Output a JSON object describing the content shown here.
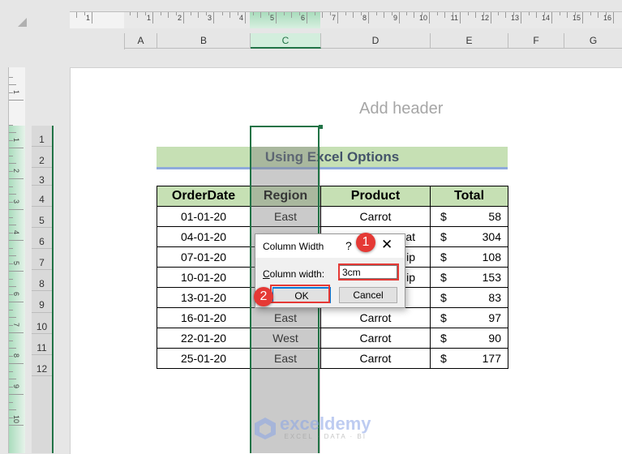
{
  "top_ruler": {
    "labels": [
      "1",
      "1",
      "2",
      "3",
      "4",
      "5",
      "6",
      "7",
      "8",
      "9",
      "10",
      "11",
      "12",
      "13",
      "14",
      "15",
      "16"
    ]
  },
  "left_ruler": {
    "labels": [
      "1",
      "1",
      "2",
      "3",
      "4",
      "5",
      "6",
      "7",
      "8",
      "9",
      "10"
    ]
  },
  "columns": [
    "A",
    "B",
    "C",
    "D",
    "E",
    "F",
    "G"
  ],
  "selected_column": "C",
  "rows": [
    "1",
    "2",
    "3",
    "4",
    "5",
    "6",
    "7",
    "8",
    "9",
    "10",
    "11",
    "12"
  ],
  "page": {
    "header_placeholder": "Add header",
    "title": "Using Excel Options"
  },
  "table": {
    "headers": [
      "OrderDate",
      "Region",
      "Product",
      "Total"
    ],
    "currency_symbol": "$",
    "rows": [
      {
        "date": "01-01-20",
        "region": "East",
        "product": "Carrot",
        "total": "58"
      },
      {
        "date": "04-01-20",
        "region": "",
        "product": "at",
        "total": "304"
      },
      {
        "date": "07-01-20",
        "region": "",
        "product": "ip",
        "total": "108"
      },
      {
        "date": "10-01-20",
        "region": "",
        "product": "ip",
        "total": "153"
      },
      {
        "date": "13-01-20",
        "region": "",
        "product": "",
        "total": "83"
      },
      {
        "date": "16-01-20",
        "region": "East",
        "product": "Carrot",
        "total": "97"
      },
      {
        "date": "22-01-20",
        "region": "West",
        "product": "Carrot",
        "total": "90"
      },
      {
        "date": "25-01-20",
        "region": "East",
        "product": "Carrot",
        "total": "177"
      }
    ]
  },
  "dialog": {
    "title": "Column Width",
    "help_label": "?",
    "close_label": "✕",
    "field_label_accel": "C",
    "field_label_rest": "olumn width:",
    "field_value": "3cm",
    "ok_label": "OK",
    "cancel_label": "Cancel"
  },
  "annotations": {
    "step1": "1",
    "step2": "2",
    "color": "#e53935"
  },
  "watermark": {
    "name": "exceldemy",
    "tagline": "EXCEL · DATA · BI"
  },
  "colors": {
    "excel_green": "#217346",
    "header_fill": "#c6e0b4",
    "title_text": "#44546a"
  }
}
